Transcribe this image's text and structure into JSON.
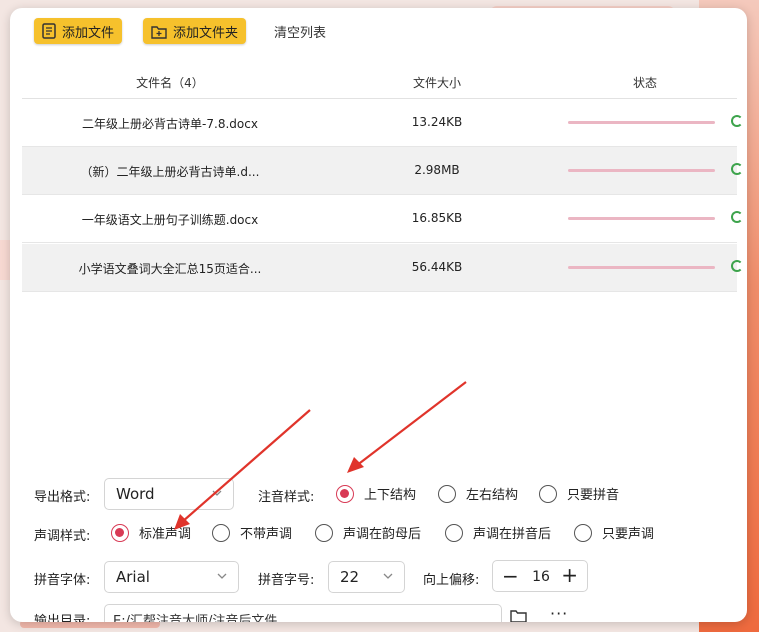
{
  "toolbar": {
    "add_file_label": "添加文件",
    "add_folder_label": "添加文件夹",
    "clear_list_label": "清空列表"
  },
  "table": {
    "headers": {
      "name": "文件名（4）",
      "size": "文件大小",
      "status": "状态"
    },
    "rows": [
      {
        "name": "二年级上册必背古诗单-7.8.docx",
        "size": "13.24KB"
      },
      {
        "name": "（新）二年级上册必背古诗单.d...",
        "size": "2.98MB"
      },
      {
        "name": "一年级语文上册句子训练题.docx",
        "size": "16.85KB"
      },
      {
        "name": "小学语文叠词大全汇总15页适合...",
        "size": "56.44KB"
      }
    ]
  },
  "settings": {
    "export_format_label": "导出格式:",
    "export_format_value": "Word",
    "annotation_style_label": "注音样式:",
    "annotation_options": [
      "上下结构",
      "左右结构",
      "只要拼音"
    ],
    "annotation_selected": "上下结构",
    "tone_style_label": "声调样式:",
    "tone_options": [
      "标准声调",
      "不带声调",
      "声调在韵母后",
      "声调在拼音后",
      "只要声调"
    ],
    "tone_selected": "标准声调",
    "pinyin_font_label": "拼音字体:",
    "pinyin_font_value": "Arial",
    "pinyin_size_label": "拼音字号:",
    "pinyin_size_value": "22",
    "offset_label": "向上偏移:",
    "offset_value": "16",
    "output_dir_label": "输出目录:",
    "output_dir_value": "E:/汇帮注音大师/注音后文件"
  },
  "colors": {
    "accent_yellow": "#f6c12c",
    "radio_selected": "#d83a55",
    "progress_bar": "#ebb6c3",
    "status_ok": "#3ca34b",
    "annotation_arrow": "#e0342b"
  }
}
